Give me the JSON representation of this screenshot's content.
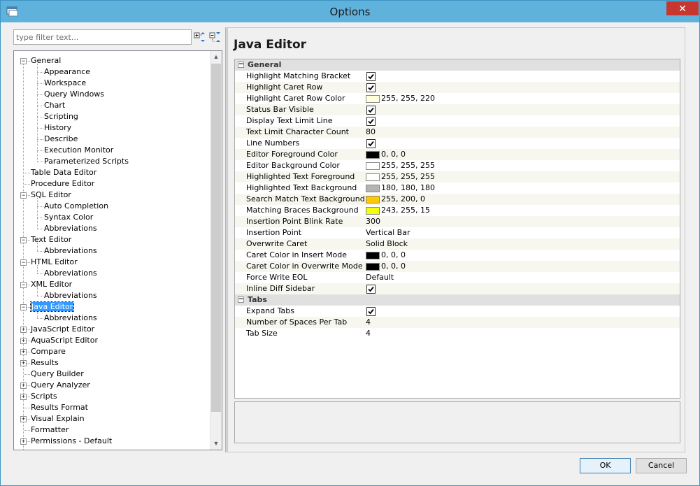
{
  "window": {
    "title": "Options",
    "close_glyph": "✕"
  },
  "filter": {
    "placeholder": "type filter text..."
  },
  "toolbar_icons": [
    "expand-all-icon",
    "collapse-all-icon"
  ],
  "tree": {
    "items": [
      {
        "label": "General",
        "level": 0,
        "expander": "−"
      },
      {
        "label": "Appearance",
        "level": 1
      },
      {
        "label": "Workspace",
        "level": 1
      },
      {
        "label": "Query Windows",
        "level": 1
      },
      {
        "label": "Chart",
        "level": 1
      },
      {
        "label": "Scripting",
        "level": 1
      },
      {
        "label": "History",
        "level": 1
      },
      {
        "label": "Describe",
        "level": 1
      },
      {
        "label": "Execution Monitor",
        "level": 1
      },
      {
        "label": "Parameterized Scripts",
        "level": 1
      },
      {
        "label": "Table Data Editor",
        "level": 0
      },
      {
        "label": "Procedure Editor",
        "level": 0
      },
      {
        "label": "SQL Editor",
        "level": 0,
        "expander": "−"
      },
      {
        "label": "Auto Completion",
        "level": 1
      },
      {
        "label": "Syntax Color",
        "level": 1
      },
      {
        "label": "Abbreviations",
        "level": 1
      },
      {
        "label": "Text Editor",
        "level": 0,
        "expander": "−"
      },
      {
        "label": "Abbreviations",
        "level": 1
      },
      {
        "label": "HTML Editor",
        "level": 0,
        "expander": "−"
      },
      {
        "label": "Abbreviations",
        "level": 1
      },
      {
        "label": "XML Editor",
        "level": 0,
        "expander": "−"
      },
      {
        "label": "Abbreviations",
        "level": 1
      },
      {
        "label": "Java Editor",
        "level": 0,
        "expander": "−",
        "selected": true
      },
      {
        "label": "Abbreviations",
        "level": 1
      },
      {
        "label": "JavaScript Editor",
        "level": 0,
        "expander": "+"
      },
      {
        "label": "AquaScript Editor",
        "level": 0,
        "expander": "+"
      },
      {
        "label": "Compare",
        "level": 0,
        "expander": "+"
      },
      {
        "label": "Results",
        "level": 0,
        "expander": "+"
      },
      {
        "label": "Query Builder",
        "level": 0
      },
      {
        "label": "Query Analyzer",
        "level": 0,
        "expander": "+"
      },
      {
        "label": "Scripts",
        "level": 0,
        "expander": "+"
      },
      {
        "label": "Results Format",
        "level": 0
      },
      {
        "label": "Visual Explain",
        "level": 0,
        "expander": "+"
      },
      {
        "label": "Formatter",
        "level": 0
      },
      {
        "label": "Permissions - Default",
        "level": 0,
        "expander": "+"
      }
    ]
  },
  "page": {
    "title": "Java Editor"
  },
  "properties": {
    "categories": [
      {
        "name": "General",
        "expander": "−",
        "rows": [
          {
            "name": "Highlight Matching Bracket",
            "type": "checkbox",
            "checked": true
          },
          {
            "name": "Highlight Caret Row",
            "type": "checkbox",
            "checked": true
          },
          {
            "name": "Highlight Caret Row Color",
            "type": "color",
            "color": "#ffffdc",
            "value": "255, 255, 220"
          },
          {
            "name": "Status Bar Visible",
            "type": "checkbox",
            "checked": true
          },
          {
            "name": "Display Text Limit Line",
            "type": "checkbox",
            "checked": true
          },
          {
            "name": "Text Limit Character Count",
            "type": "text",
            "value": "80"
          },
          {
            "name": "Line Numbers",
            "type": "checkbox",
            "checked": true
          },
          {
            "name": "Editor Foreground Color",
            "type": "color",
            "color": "#000000",
            "value": "0, 0, 0"
          },
          {
            "name": "Editor Background Color",
            "type": "color",
            "color": "#ffffff",
            "value": "255, 255, 255"
          },
          {
            "name": "Highlighted Text Foreground",
            "type": "color",
            "color": "#ffffff",
            "value": "255, 255, 255"
          },
          {
            "name": "Highlighted Text Background",
            "type": "color",
            "color": "#b4b4b4",
            "value": "180, 180, 180"
          },
          {
            "name": "Search Match Text Background",
            "type": "color",
            "color": "#ffc800",
            "value": "255, 200, 0"
          },
          {
            "name": "Matching Braces Background",
            "type": "color",
            "color": "#f3ff0f",
            "value": "243, 255, 15"
          },
          {
            "name": "Insertion Point Blink Rate",
            "type": "text",
            "value": "300"
          },
          {
            "name": "Insertion Point",
            "type": "text",
            "value": "Vertical Bar"
          },
          {
            "name": "Overwrite Caret",
            "type": "text",
            "value": "Solid Block"
          },
          {
            "name": "Caret Color in Insert Mode",
            "type": "color",
            "color": "#000000",
            "value": "0, 0, 0"
          },
          {
            "name": "Caret Color in Overwrite Mode",
            "type": "color",
            "color": "#000000",
            "value": "0, 0, 0"
          },
          {
            "name": "Force Write EOL",
            "type": "text",
            "value": "Default"
          },
          {
            "name": "Inline Diff Sidebar",
            "type": "checkbox",
            "checked": true
          }
        ]
      },
      {
        "name": "Tabs",
        "expander": "−",
        "rows": [
          {
            "name": "Expand Tabs",
            "type": "checkbox",
            "checked": true
          },
          {
            "name": "Number of Spaces Per Tab",
            "type": "text",
            "value": "4"
          },
          {
            "name": "Tab Size",
            "type": "text",
            "value": "4"
          }
        ]
      }
    ]
  },
  "buttons": {
    "ok": "OK",
    "cancel": "Cancel"
  }
}
